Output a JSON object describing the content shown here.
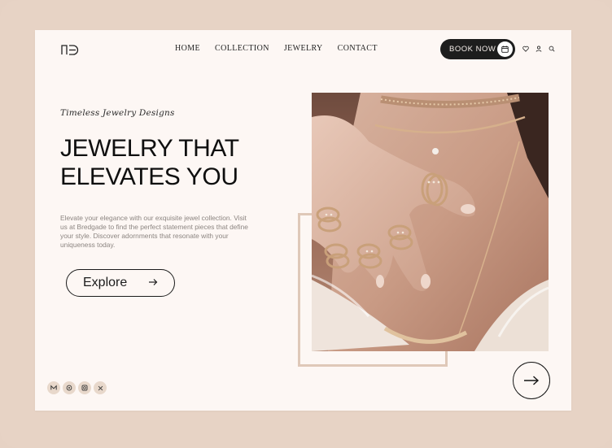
{
  "brand": {
    "logo_icon": "brand-monogram-icon"
  },
  "nav": {
    "items": [
      {
        "label": "HOME"
      },
      {
        "label": "COLLECTION"
      },
      {
        "label": "JEWELRY"
      },
      {
        "label": "CONTACT"
      }
    ]
  },
  "header": {
    "book_label": "BOOK NOW",
    "book_icon": "calendar-icon",
    "icons": [
      "heart-icon",
      "user-icon",
      "search-icon"
    ]
  },
  "hero": {
    "tagline": "Timeless Jewelry Designs",
    "headline_line1": "JEWELRY THAT",
    "headline_line2": "ELEVATES YOU",
    "description": "Elevate your elegance with our exquisite jewel collection. Visit us at Bredgade to find the perfect statement pieces that define your style. Discover adornments that resonate with your uniqueness today.",
    "cta_label": "Explore",
    "cta_icon": "arrow-right-icon",
    "image_subject": "hand-with-gold-rings-and-necklace-photo"
  },
  "socials": [
    "medium-icon",
    "pinterest-icon",
    "instagram-icon",
    "x-icon"
  ],
  "next_icon": "arrow-right-icon",
  "colors": {
    "outer_bg": "#e7d3c5",
    "page_bg": "#fdf7f4",
    "accent_dark": "#1d1d1d",
    "frame_accent": "#dfc8b8"
  }
}
